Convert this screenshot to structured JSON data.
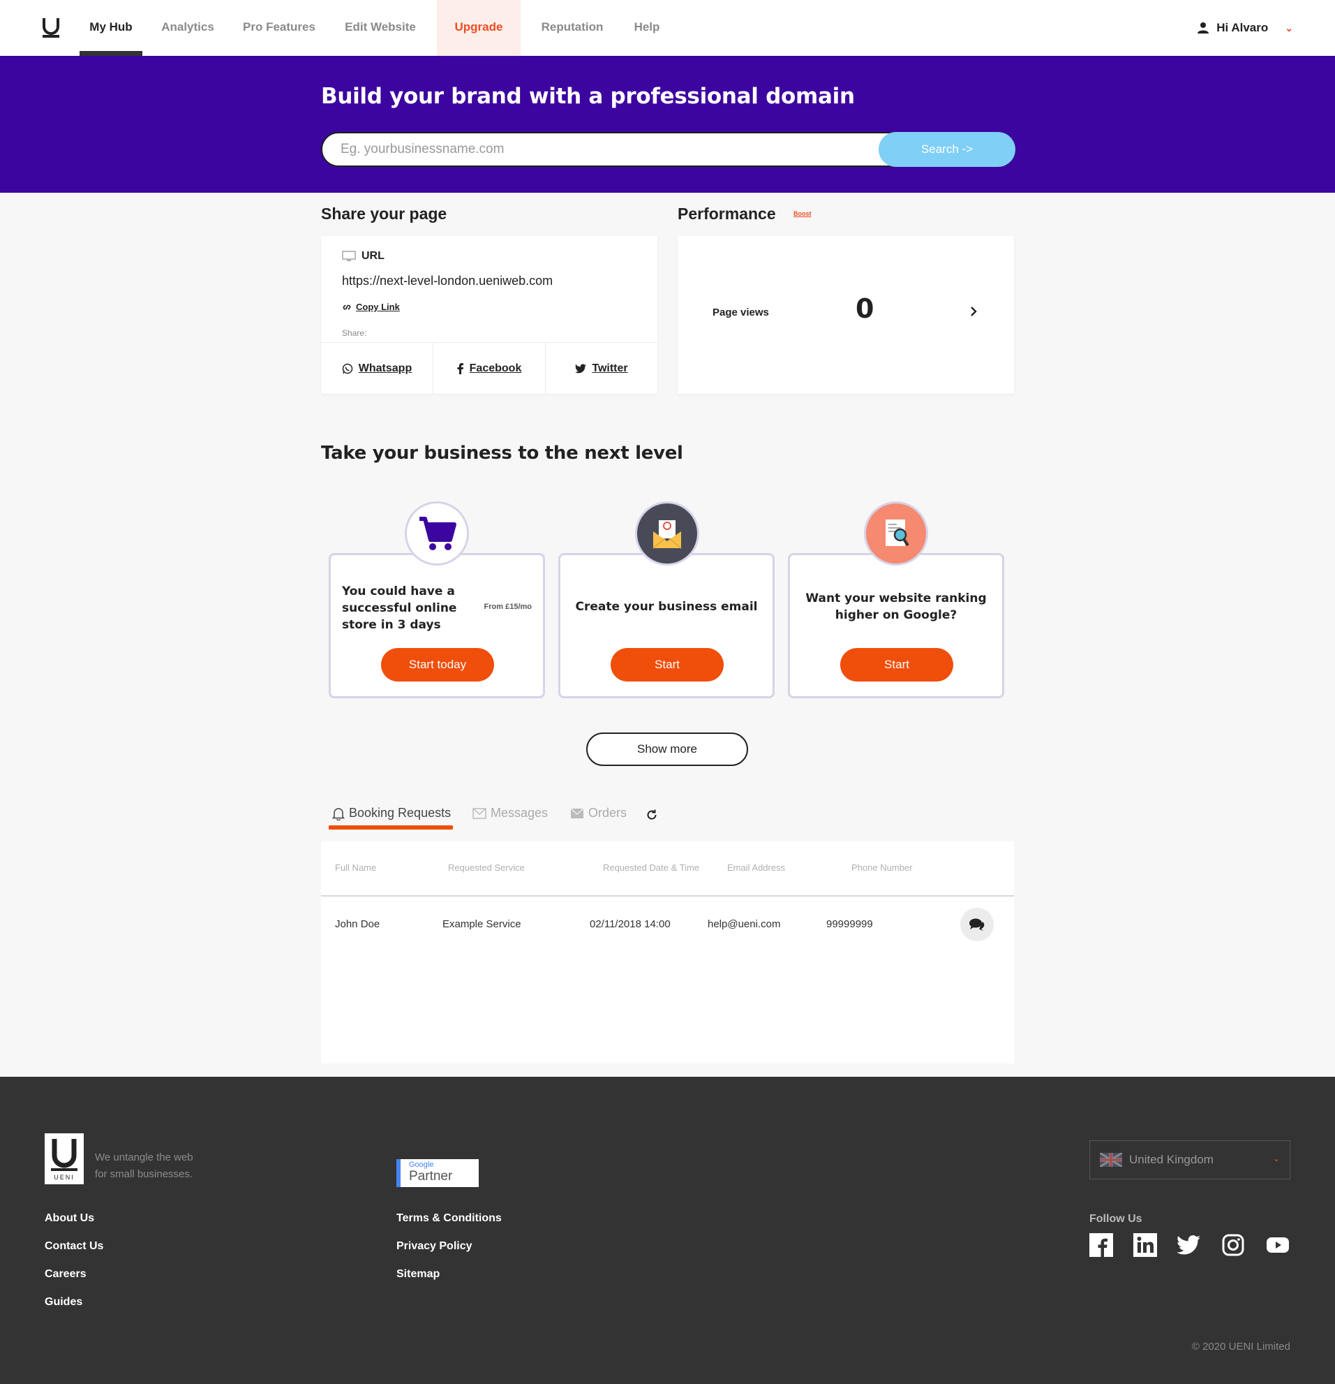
{
  "nav": {
    "items": [
      {
        "label": "My Hub"
      },
      {
        "label": "Analytics"
      },
      {
        "label": "Pro Features"
      },
      {
        "label": "Edit Website"
      },
      {
        "label": "Upgrade"
      },
      {
        "label": "Reputation"
      },
      {
        "label": "Help"
      }
    ],
    "user_greeting": "Hi Alvaro"
  },
  "hero": {
    "title": "Build your brand with a professional domain",
    "search_placeholder": "Eg. yourbusinessname.com",
    "search_button": "Search ->"
  },
  "share": {
    "heading": "Share your page",
    "url_label": "URL",
    "url_value": "https://next-level-london.ueniweb.com",
    "copy_link": "Copy Link",
    "share_label": "Share:",
    "whatsapp": "Whatsapp",
    "facebook": "Facebook",
    "twitter": "Twitter"
  },
  "performance": {
    "heading": "Performance",
    "boost": "Boost",
    "page_views_label": "Page views",
    "page_views_value": "0"
  },
  "next_level": {
    "heading": "Take your business to the next level",
    "cards": [
      {
        "text": "You could have a successful online store in 3 days",
        "sub": "From £15/mo",
        "button": "Start today",
        "icon": "shopping-cart-icon"
      },
      {
        "text": "Create your business email",
        "button": "Start",
        "icon": "email-envelope-icon"
      },
      {
        "text": "Want your website ranking higher on Google?",
        "button": "Start",
        "icon": "seo-search-icon"
      }
    ],
    "show_more": "Show more"
  },
  "tabs": {
    "booking": "Booking Requests",
    "messages": "Messages",
    "orders": "Orders"
  },
  "table": {
    "headers": [
      "Full Name",
      "Requested Service",
      "Requested Date & Time",
      "Email Address",
      "Phone Number"
    ],
    "rows": [
      [
        "John Doe",
        "Example Service",
        "02/11/2018 14:00",
        "help@ueni.com",
        "99999999"
      ]
    ]
  },
  "footer": {
    "tagline_1": "We untangle the web",
    "tagline_2": "for small businesses.",
    "logo_text": "UENI",
    "col1": [
      "About Us",
      "Contact Us",
      "Careers",
      "Guides"
    ],
    "col2": [
      "Terms & Conditions",
      "Privacy Policy",
      "Sitemap"
    ],
    "google_small": "Google",
    "google_partner": "Partner",
    "country": "United Kingdom",
    "follow_us": "Follow Us",
    "copyright": "© 2020 UENI Limited"
  },
  "colors": {
    "hero_bg": "#3d05a0",
    "accent_orange": "#f04e0b",
    "search_button": "#7fcff7",
    "footer_bg": "#333333"
  }
}
